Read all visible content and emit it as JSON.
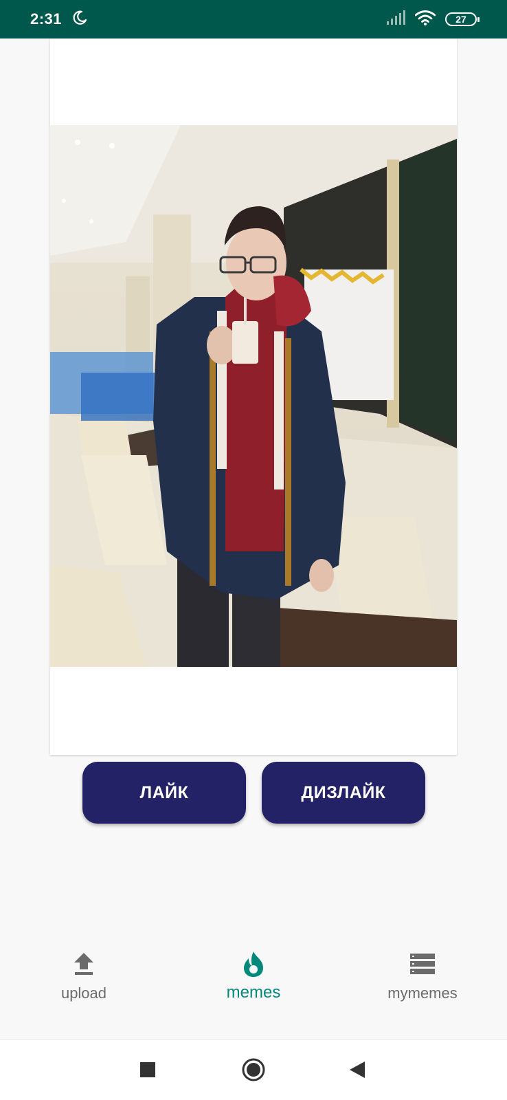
{
  "status_bar": {
    "time": "2:31",
    "battery": "27",
    "icons": [
      "moon-icon",
      "signal-icon",
      "wifi-icon",
      "battery-icon"
    ]
  },
  "meme": {
    "image_description_icon": "photo"
  },
  "actions": {
    "like_label": "ЛАЙК",
    "dislike_label": "ДИЗЛАЙК"
  },
  "bottom_nav": {
    "items": [
      {
        "label": "upload",
        "icon": "upload-icon",
        "active": false
      },
      {
        "label": "memes",
        "icon": "flame-icon",
        "active": true
      },
      {
        "label": "mymemes",
        "icon": "list-icon",
        "active": false
      }
    ]
  },
  "colors": {
    "status_bar": "#00574b",
    "button": "#232266",
    "nav_active": "#00897b",
    "nav_inactive": "#6b6b6b"
  }
}
